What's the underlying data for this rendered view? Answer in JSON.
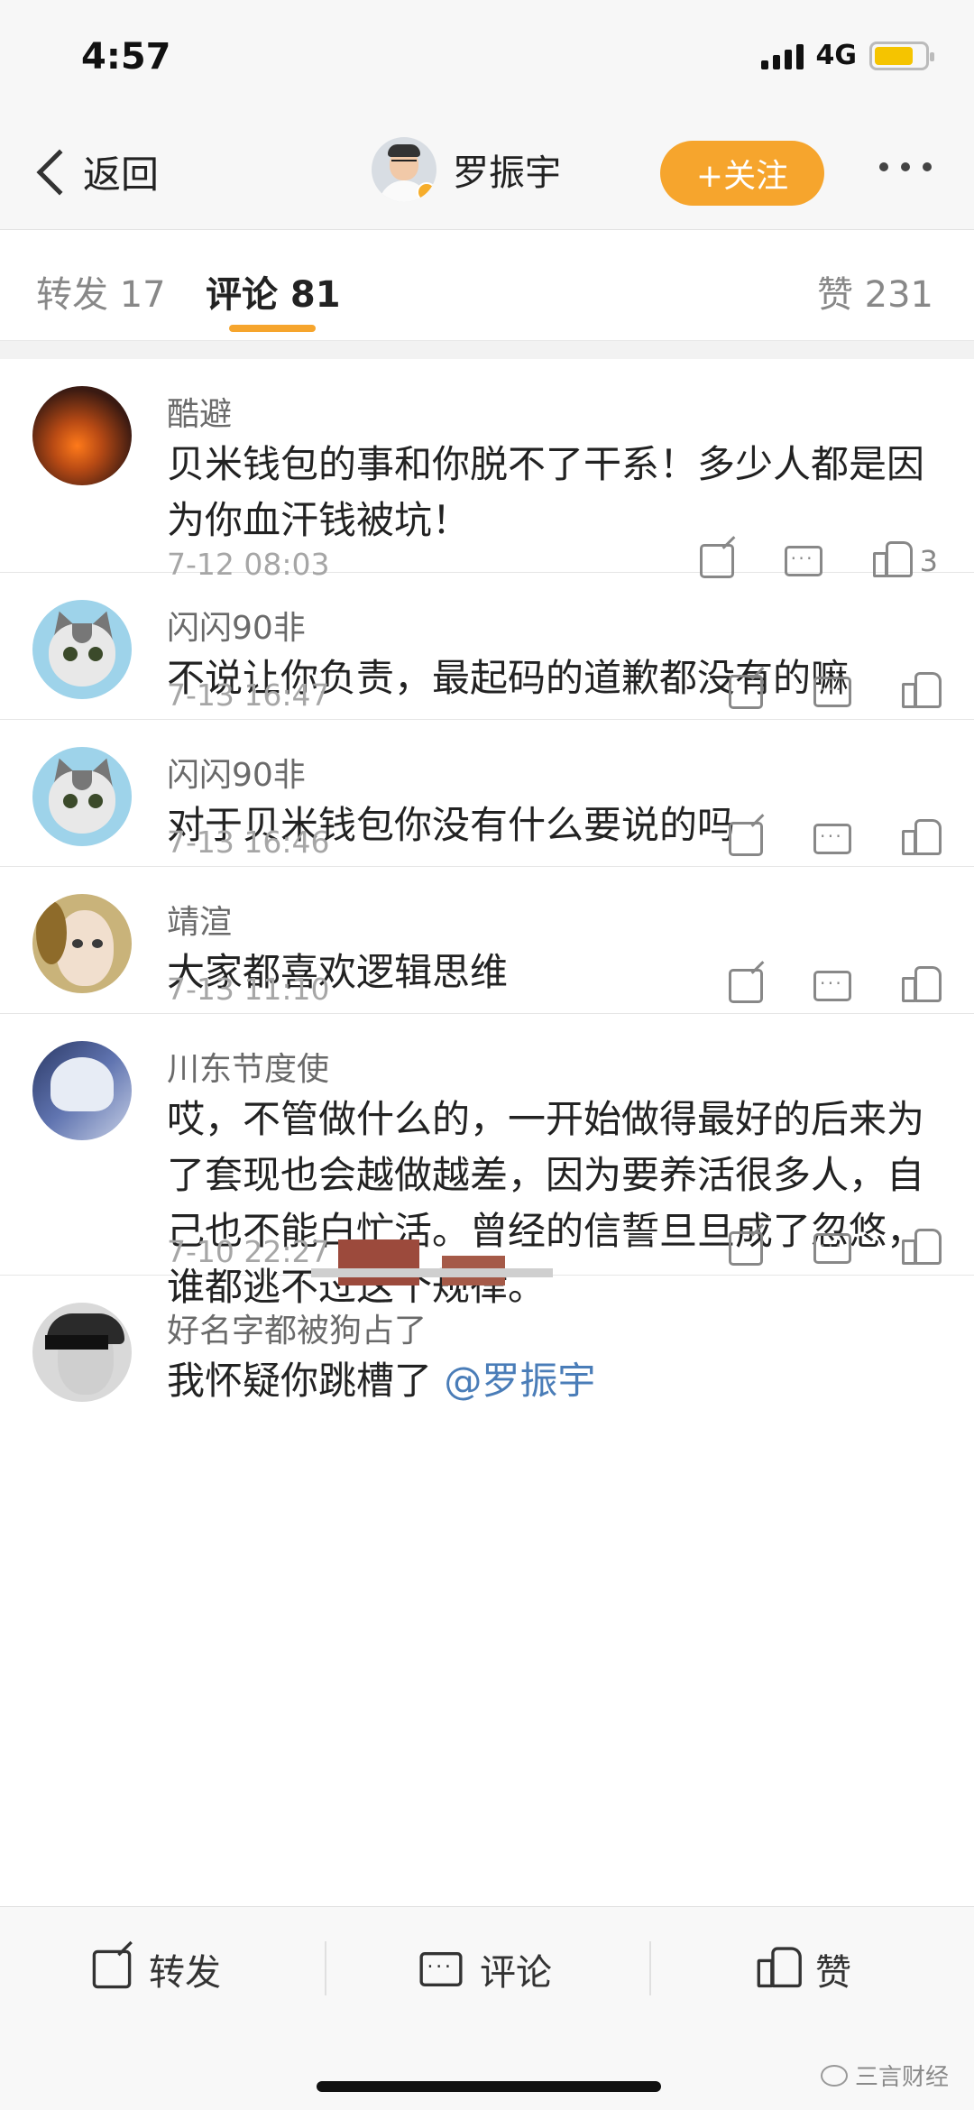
{
  "status_bar": {
    "time": "4:57",
    "network": "4G",
    "battery_level": 0.78
  },
  "nav": {
    "back_label": "返回",
    "profile_name": "罗振宇",
    "follow_label": "+关注"
  },
  "tabs": {
    "repost": "转发 17",
    "comment": "评论 81",
    "like": "赞 231"
  },
  "comments": [
    {
      "name": "酷避",
      "text": "贝米钱包的事和你脱不了干系！多少人都是因为你血汗钱被坑！",
      "time": "7-12 08:03",
      "likes": "3"
    },
    {
      "name": "闪闪90非",
      "text": "不说让你负责，最起码的道歉都没有的嘛",
      "time": "7-13 16:47",
      "likes": ""
    },
    {
      "name": "闪闪90非",
      "text": "对于贝米钱包你没有什么要说的吗",
      "time": "7-13 16:46",
      "likes": ""
    },
    {
      "name": "靖渲",
      "text": "大家都喜欢逻辑思维",
      "time": "7-13 11:10",
      "likes": ""
    },
    {
      "name": "川东节度使",
      "text": "哎，不管做什么的，一开始做得最好的后来为了套现也会越做越差，因为要养活很多人，自己也不能白忙活。曾经的信誓旦旦成了忽悠，谁都逃不过这个规律。",
      "time": "7-10 22:27",
      "likes": ""
    },
    {
      "name": "好名字都被狗占了",
      "text": "我怀疑你跳槽了",
      "mention": "@罗振宇"
    }
  ],
  "bottom_bar": {
    "repost": "转发",
    "comment": "评论",
    "like": "赞"
  },
  "watermark": "三言财经",
  "colors": {
    "accent": "#f6a52d",
    "mention": "#4a7db8"
  }
}
